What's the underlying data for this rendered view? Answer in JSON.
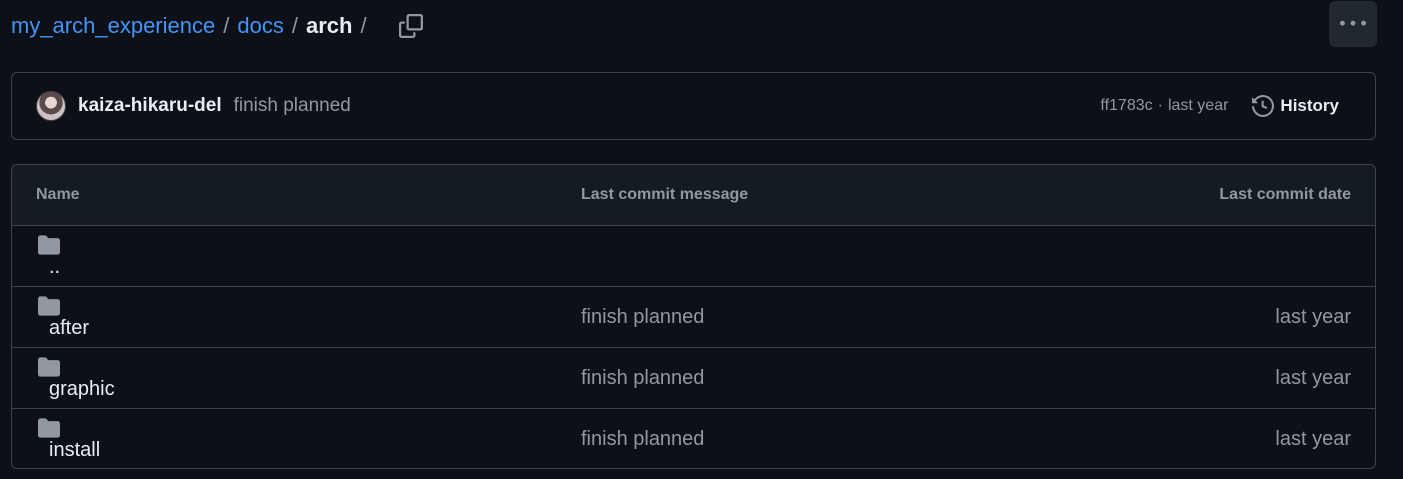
{
  "breadcrumb": {
    "repo": "my_arch_experience",
    "sep1": "/",
    "dir1": "docs",
    "sep2": "/",
    "current": "arch",
    "sep3": "/"
  },
  "icons": {
    "copy": "copy-icon",
    "more": "kebab-horizontal-icon",
    "history": "history-icon",
    "folder": "file-directory-fill-icon"
  },
  "colors": {
    "background": "#0d1117",
    "link": "#4493f8",
    "muted": "#9198a1",
    "border": "#3d444d",
    "folder": "#9198a1"
  },
  "latest_commit": {
    "author": "kaiza-hikaru-del",
    "message": "finish planned",
    "sha": "ff1783c",
    "dot": "·",
    "age": "last year",
    "history_label": "History"
  },
  "table": {
    "headers": {
      "name": "Name",
      "message": "Last commit message",
      "date": "Last commit date"
    },
    "rows": [
      {
        "name": "..",
        "message": "",
        "date": ""
      },
      {
        "name": "after",
        "message": "finish planned",
        "date": "last year"
      },
      {
        "name": "graphic",
        "message": "finish planned",
        "date": "last year"
      },
      {
        "name": "install",
        "message": "finish planned",
        "date": "last year"
      }
    ]
  }
}
